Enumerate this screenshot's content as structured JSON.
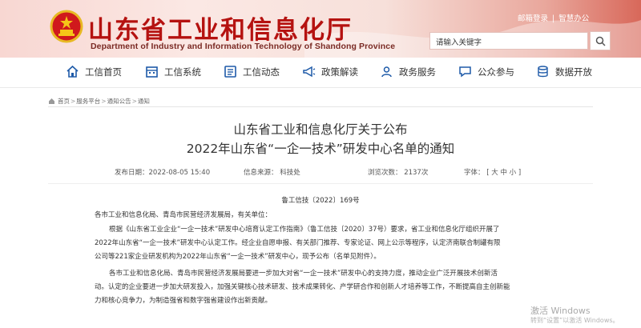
{
  "header": {
    "title": "山东省工业和信息化厅",
    "subtitle": "Department of Industry and Information Technology of Shandong Province",
    "links": [
      "邮箱登录",
      "智慧办公"
    ],
    "search_placeholder": "请输入关键字"
  },
  "nav": [
    {
      "label": "工信首页",
      "icon": "home-icon"
    },
    {
      "label": "工信系统",
      "icon": "building-icon"
    },
    {
      "label": "工信动态",
      "icon": "news-icon"
    },
    {
      "label": "政策解读",
      "icon": "megaphone-icon"
    },
    {
      "label": "政务服务",
      "icon": "service-icon"
    },
    {
      "label": "公众参与",
      "icon": "chat-icon"
    },
    {
      "label": "数据开放",
      "icon": "data-icon"
    }
  ],
  "breadcrumb": [
    "首页",
    "服务平台",
    "通知公告",
    "通知"
  ],
  "article": {
    "title_line1": "山东省工业和信息化厅关于公布",
    "title_line2": "2022年山东省“一企一技术”研发中心名单的通知",
    "publish_date": "发布日期：2022-08-05 15:40",
    "source": "信息来源：  科技处",
    "views": "浏览次数：  2137次",
    "font_size_label": "字体：",
    "font_size_options": "[ 大  中  小 ]",
    "doc_number": "鲁工信技〔2022〕169号",
    "salutation": "各市工业和信息化局、青岛市民营经济发展局，有关单位：",
    "para1": [
      "根据《山东省工业企业“一企一技术”研发中心培育认定工作指南》（鲁工信技〔2020〕37号）要求，省工业和信息化厅组织开展了",
      "2022年山东省“一企一技术”研发中心认定工作。经企业自愿申报、有关部门推荐、专家论证、网上公示等程序，认定济南联合制罐有限",
      "公司等221家企业研发机构为2022年山东省“一企一技术”研发中心，现予公布（名单见附件）。"
    ],
    "para2": [
      "各市工业和信息化局、青岛市民营经济发展局要进一步加大对省“一企一技术”研发中心的支持力度，推动企业广泛开展技术创新活",
      "动。认定的企业要进一步加大研发投入，加强关键核心技术研发、技术成果转化、产学研合作和创新人才培养等工作，不断提高自主创新能",
      "力和核心竞争力，为制造强省和数字强省建设作出新贡献。"
    ]
  },
  "os_watermark": {
    "line1": "激活 Windows",
    "line2": "转到“设置”以激活 Windows。"
  },
  "colors": {
    "title_red": "#b51210",
    "nav_icon_blue": "#1e5aa8",
    "header_gradient_end": "#d8685a"
  }
}
